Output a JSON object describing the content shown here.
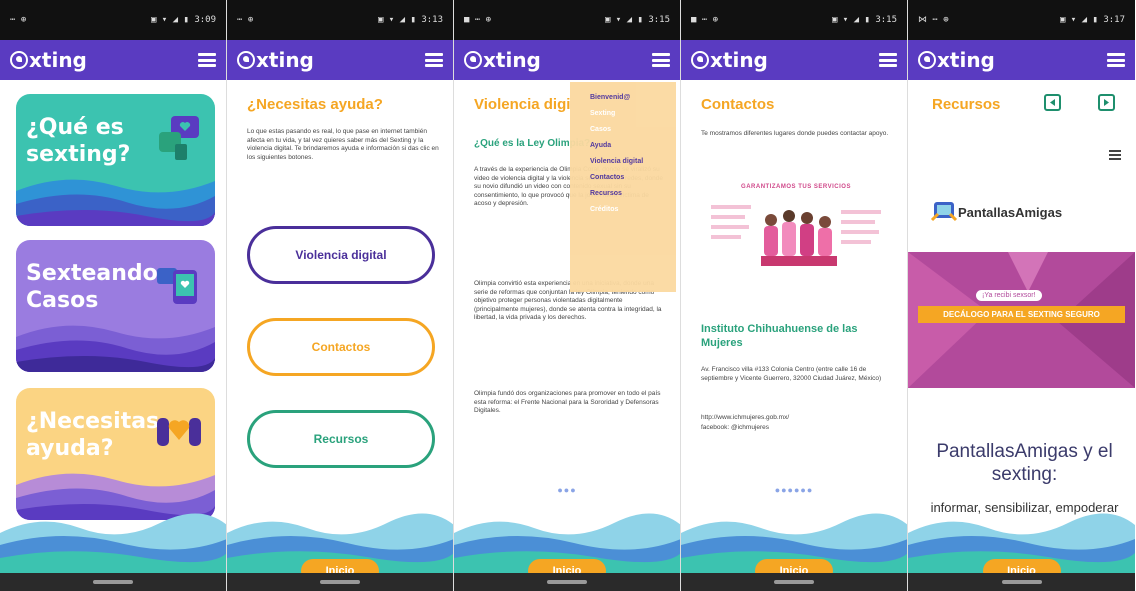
{
  "screens": [
    {
      "status_left": "⋯ ⊕",
      "status_right": "▣ ▾ ◢ ▮ 3:09",
      "logo_text": "xting",
      "cards": [
        {
          "title": "¿Qué es sexting?"
        },
        {
          "title": "Sexteando: Casos"
        },
        {
          "title": "¿Necesitas ayuda?"
        }
      ]
    },
    {
      "status_left": "⋯ ⊕",
      "status_right": "▣ ▾ ◢ ▮ 3:13",
      "logo_text": "xting",
      "heading": "¿Necesitas ayuda?",
      "paragraph": "Lo que estas pasando es real, lo que pase en internet también afecta en tu vida, y tal vez quieres saber más del Sexting y la violencia digital. Te brindaremos ayuda e información si das clic en los siguientes botones.",
      "buttons": [
        "Violencia digital",
        "Contactos",
        "Recursos"
      ],
      "inicio": "Inicio"
    },
    {
      "status_left": "■ ⋯ ⊕",
      "status_right": "▣ ▾ ◢ ▮ 3:15",
      "logo_text": "xting",
      "heading": "Violencia digi",
      "subheading": "¿Qué es la Ley Olimpia?",
      "paragraph1": "A través de la experiencia de Olimpia Coral, donde se viralizó su video de violencia digital y la violencia sexual en las redes, donde su novio difundió un video con contenido sexual sin su consentimiento, lo que provocó que la joven fuera víctima de acoso y depresión.",
      "paragraph2": "Olimpia convirtió esta experiencia en una iniciativa, donde una serie de reformas que conjuntan la ley Olimpia, teniendo como objetivo proteger personas violentadas digitalmente (principalmente mujeres), donde se atenta contra la integridad, la libertad, la vida privada y los derechos.",
      "paragraph3": "Olimpia fundó dos organizaciones para promover en todo el país esta reforma: el Frente Nacional para la Sororidad y Defensoras Digitales.",
      "menu_items": [
        "Bienvenid@",
        "Sexting",
        "Casos",
        "Ayuda",
        "Violencia digital",
        "Contactos",
        "Recursos",
        "Créditos"
      ],
      "dots": "●●●",
      "inicio": "Inicio"
    },
    {
      "status_left": "■ ⋯ ⊕",
      "status_right": "▣ ▾ ◢ ▮ 3:15",
      "logo_text": "xting",
      "heading": "Contactos",
      "paragraph": "Te mostramos diferentes lugares donde puedes contactar apoyo.",
      "banner_title": "GARANTIZAMOS TUS SERVICIOS",
      "org_name": "Instituto Chihuahuense de las Mujeres",
      "address": "Av. Francisco villa #133 Colonia Centro (entre calle 16 de septiembre y Vicente Guerrero, 32000 Ciudad Juárez, México)",
      "web": "http://www.ichmujeres.gob.mx/",
      "facebook": "facebook: @ichmujeres",
      "dots": "●●●●●●",
      "inicio": "Inicio"
    },
    {
      "status_left": "⋈ ⋯ ⊕",
      "status_right": "▣ ▾ ◢ ▮ 3:17",
      "logo_text": "xting",
      "heading": "Recursos",
      "brand": "PantallasAmigas",
      "promo_badge": "¡Ya recibi sexsor!",
      "promo_title": "DECÁLOGO PARA EL SEXTING SEGURO",
      "article_title": "PantallasAmigas y el sexting:",
      "article_sub": "informar, sensibilizar, empoderar",
      "inicio": "Inicio"
    }
  ],
  "colors": {
    "app_bar": "#5a3bc1",
    "accent_orange": "#f5a623",
    "teal": "#2aa27c",
    "purple": "#4a2f9a"
  }
}
